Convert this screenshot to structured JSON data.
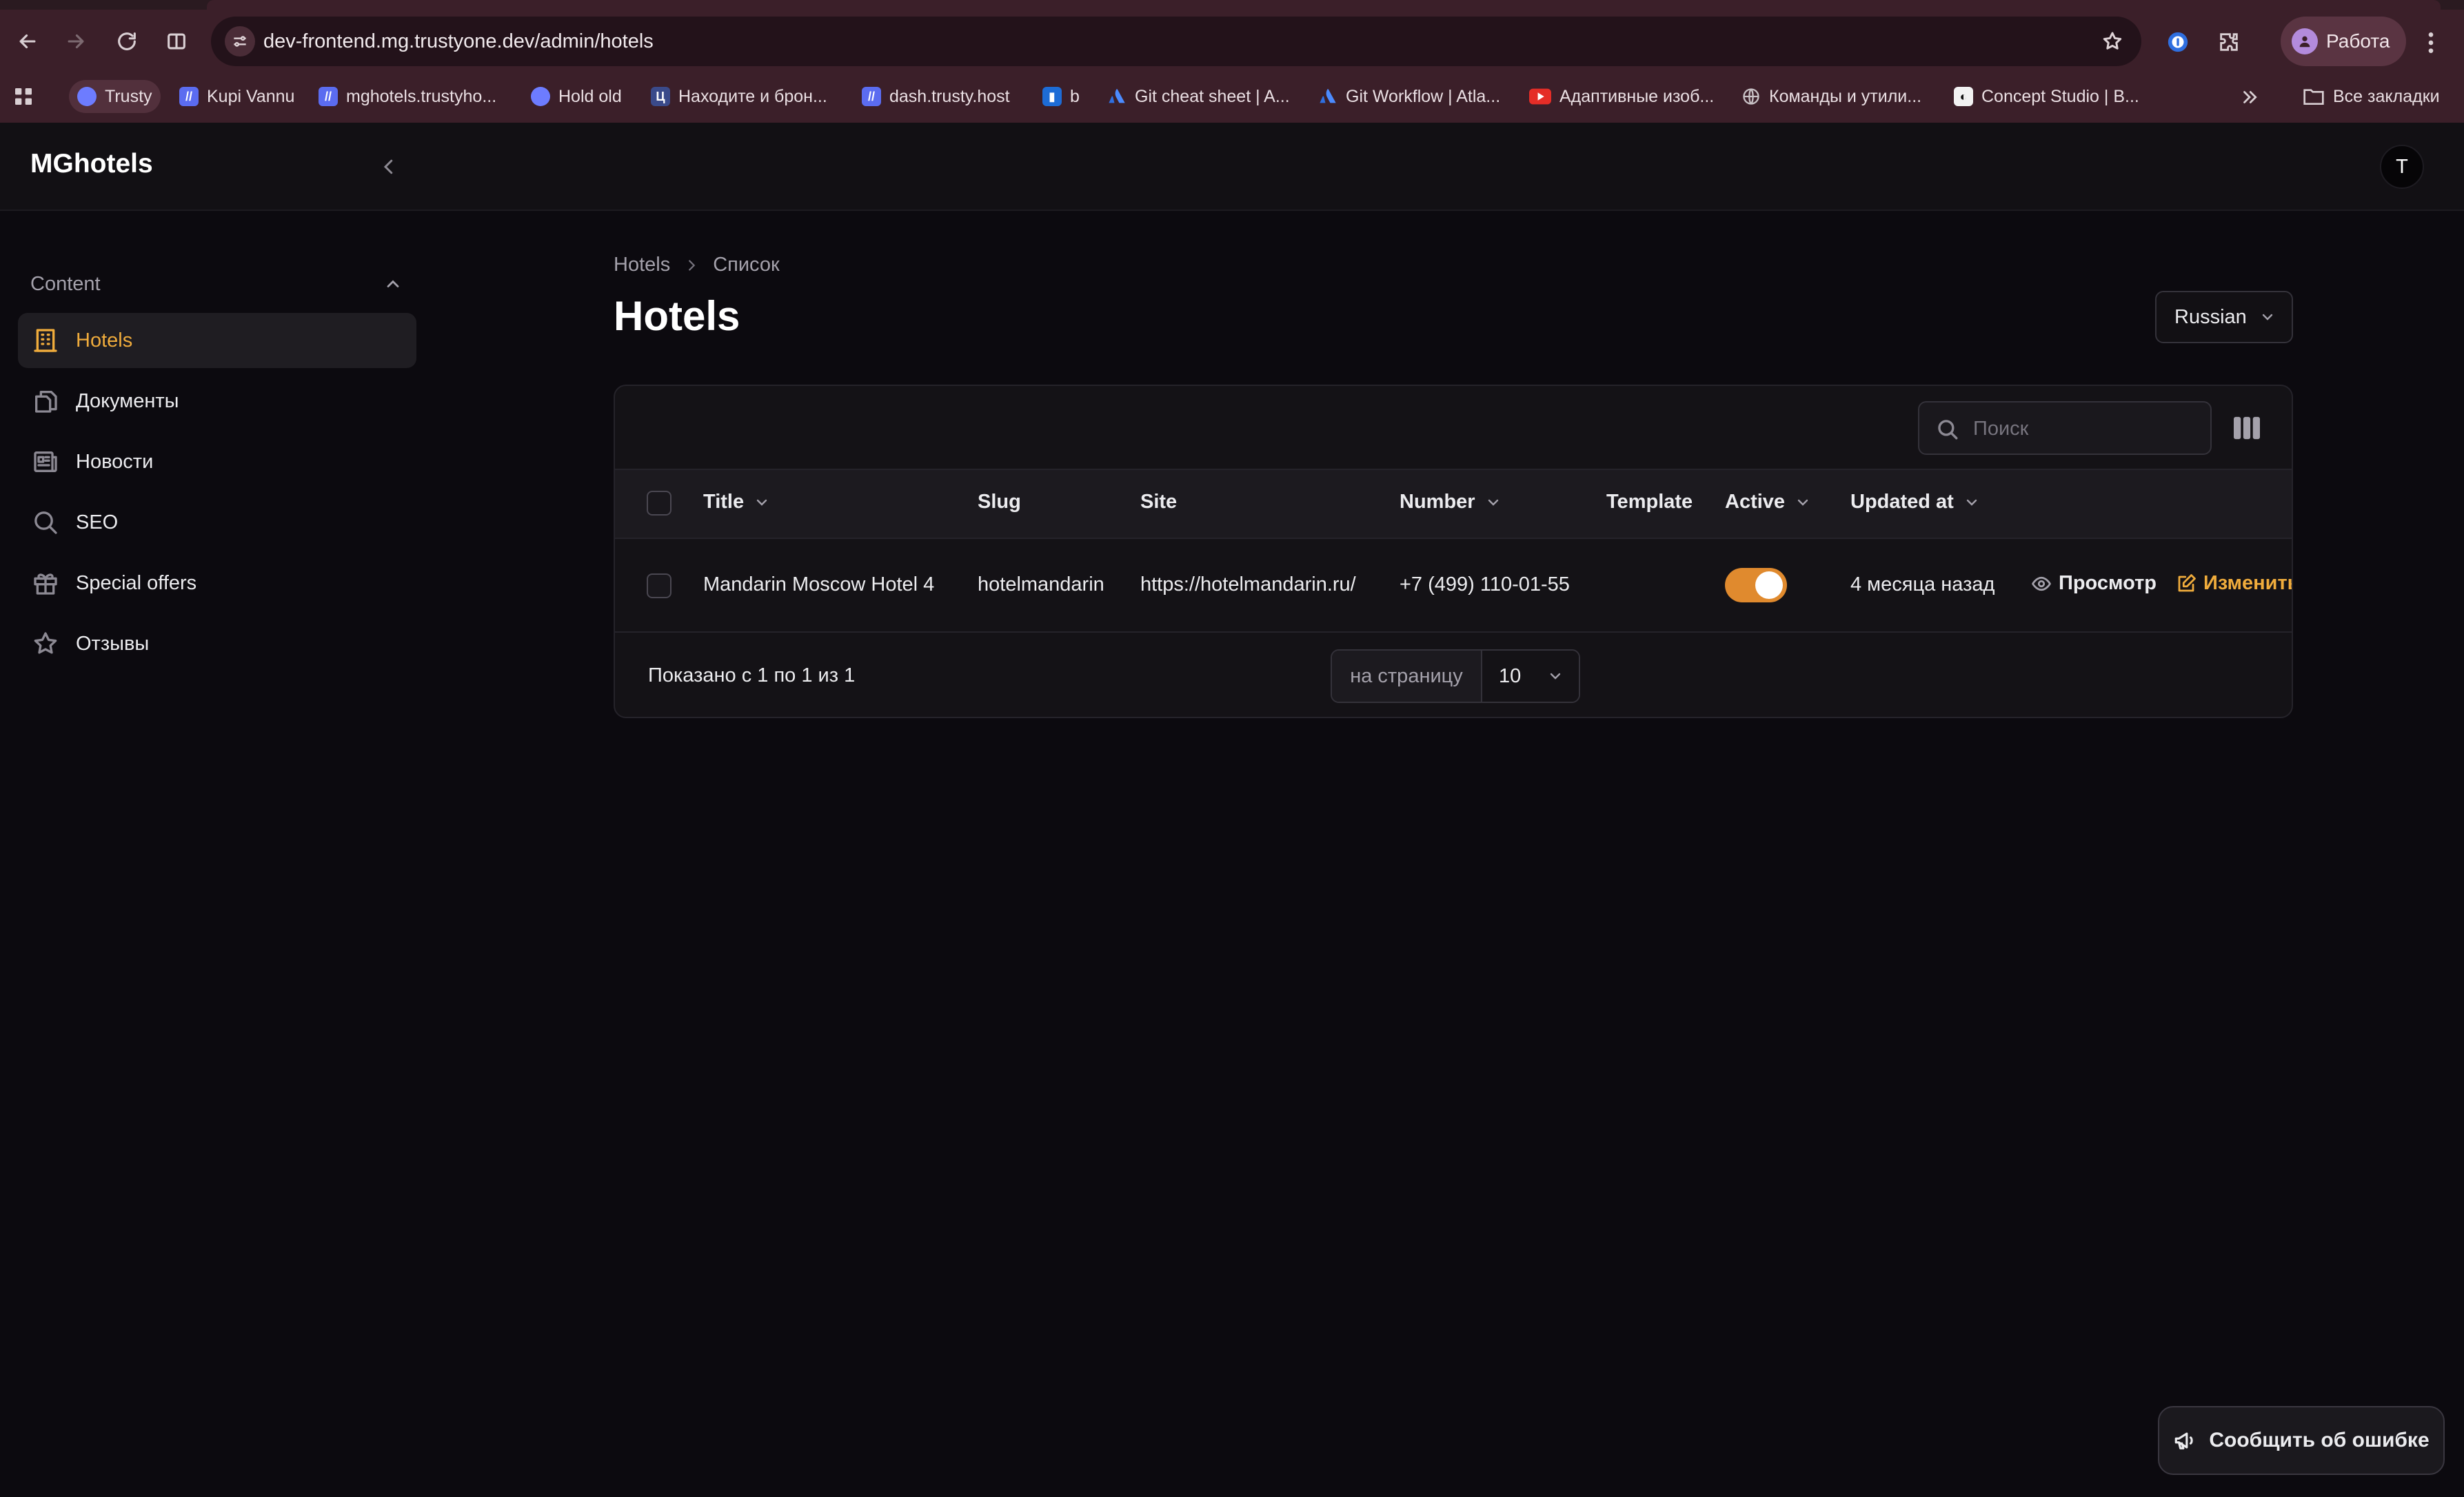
{
  "browser": {
    "url": "dev-frontend.mg.trustyone.dev/admin/hotels",
    "profile_label": "Работа",
    "bookmarks": [
      {
        "label": "Trusty",
        "icon": "trusty-favicon",
        "color": "#6d7cff"
      },
      {
        "label": "Kupi Vannu",
        "icon": "slash-favicon",
        "color": "#5b6cf0"
      },
      {
        "label": "mghotels.trustyho...",
        "icon": "slash-favicon",
        "color": "#5b6cf0"
      },
      {
        "label": "Hold old",
        "icon": "trusty-favicon",
        "color": "#6d7cff"
      },
      {
        "label": "Находите и брон...",
        "icon": "booking-favicon",
        "color": "#3a4a8a"
      },
      {
        "label": "dash.trusty.host",
        "icon": "slash-favicon",
        "color": "#5b6cf0"
      },
      {
        "label": "b",
        "icon": "trello-favicon",
        "color": "#1d6cd6"
      },
      {
        "label": "Git cheat sheet | A...",
        "icon": "atlassian-favicon",
        "color": "#2f6fe0"
      },
      {
        "label": "Git Workflow | Atla...",
        "icon": "atlassian-favicon",
        "color": "#2f6fe0"
      },
      {
        "label": "Адаптивные изоб...",
        "icon": "youtube-favicon",
        "color": "#e52d27"
      },
      {
        "label": "Команды и утили...",
        "icon": "globe-favicon",
        "color": "#9a9aa0"
      },
      {
        "label": "Concept Studio | B...",
        "icon": "concept-favicon",
        "color": "#f2f2f2"
      }
    ],
    "all_bookmarks_label": "Все закладки"
  },
  "app": {
    "brand": "MGhotels",
    "user_initial": "T"
  },
  "sidebar": {
    "group_label": "Content",
    "items": [
      {
        "label": "Hotels",
        "icon": "building-icon",
        "active": true
      },
      {
        "label": "Документы",
        "icon": "documents-icon",
        "active": false
      },
      {
        "label": "Новости",
        "icon": "newspaper-icon",
        "active": false
      },
      {
        "label": "SEO",
        "icon": "search-icon",
        "active": false
      },
      {
        "label": "Special offers",
        "icon": "gift-icon",
        "active": false
      },
      {
        "label": "Отзывы",
        "icon": "star-icon",
        "active": false
      }
    ]
  },
  "page": {
    "breadcrumb": [
      "Hotels",
      "Список"
    ],
    "title": "Hotels",
    "language": "Russian"
  },
  "table": {
    "search_placeholder": "Поиск",
    "columns": [
      {
        "label": "Title",
        "sortable": true
      },
      {
        "label": "Slug",
        "sortable": false
      },
      {
        "label": "Site",
        "sortable": false
      },
      {
        "label": "Number",
        "sortable": true
      },
      {
        "label": "Template",
        "sortable": false
      },
      {
        "label": "Active",
        "sortable": true
      },
      {
        "label": "Updated at",
        "sortable": true
      }
    ],
    "rows": [
      {
        "title": "Mandarin Moscow Hotel 4",
        "slug": "hotelmandarin",
        "site": "https://hotelmandarin.ru/",
        "number": "+7 (499) 110-01-55",
        "template": "",
        "active": true,
        "updated_at": "4 месяца назад",
        "view_label": "Просмотр",
        "edit_label": "Изменить"
      }
    ],
    "shown_text": "Показано с 1 по 1 из 1",
    "per_page_label": "на страницу",
    "per_page_value": "10"
  },
  "report_button": "Сообщить об ошибке",
  "colors": {
    "accent": "#f0ac3c",
    "toggle_on": "#e08a2e",
    "chrome": "#3b1f29",
    "background": "#0c0a0f"
  }
}
